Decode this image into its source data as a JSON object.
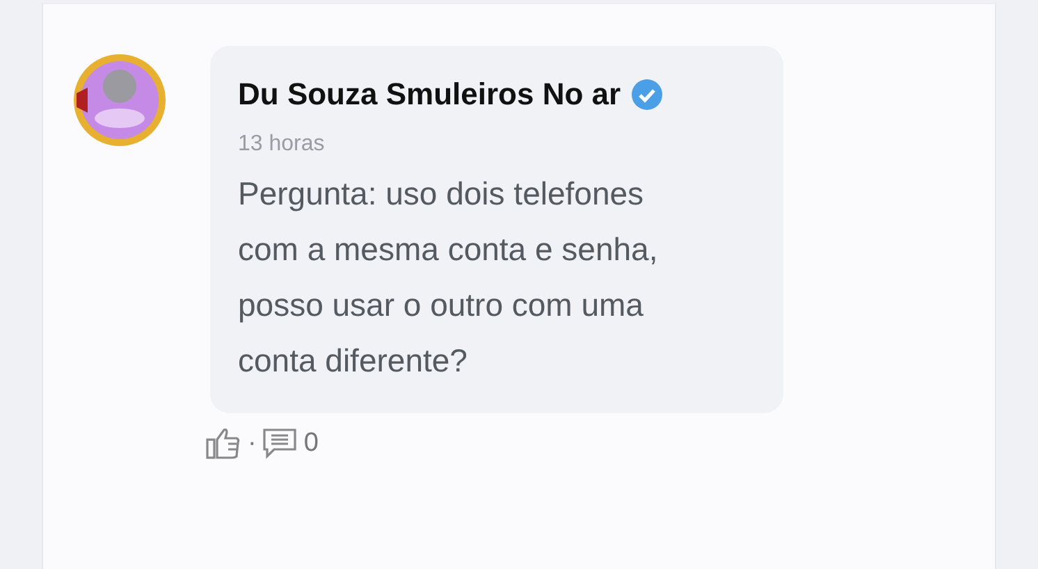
{
  "post": {
    "author": "Du Souza Smuleiros No ar",
    "verified": true,
    "time": "13 horas",
    "text": "Pergunta: uso dois telefones com a mesma conta e senha, posso usar o outro com uma conta diferente?"
  },
  "actions": {
    "separator": "·",
    "comment_count": "0"
  }
}
